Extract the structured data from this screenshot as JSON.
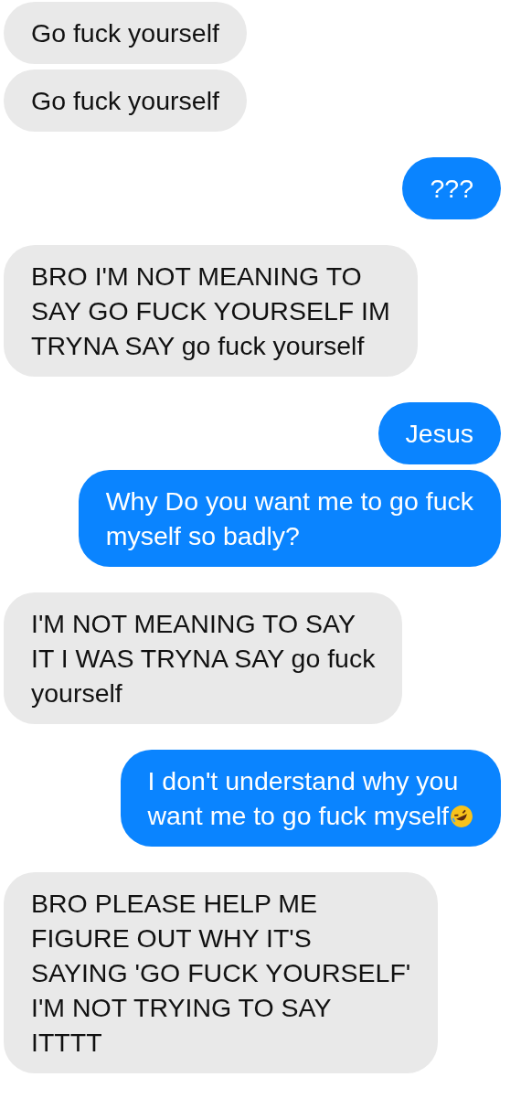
{
  "groups": [
    {
      "kind": "received",
      "messages": [
        {
          "text": "Go fuck yourself"
        },
        {
          "text": "Go fuck yourself"
        }
      ]
    },
    {
      "kind": "sent",
      "messages": [
        {
          "text": "???"
        }
      ]
    },
    {
      "kind": "received",
      "messages": [
        {
          "text": "BRO I'M NOT MEANING TO\nSAY GO FUCK YOURSELF IM\nTRYNA SAY go fuck yourself"
        }
      ]
    },
    {
      "kind": "sent",
      "messages": [
        {
          "text": "Jesus"
        },
        {
          "text": "Why Do you want me to go fuck\nmyself so badly?"
        }
      ]
    },
    {
      "kind": "received",
      "messages": [
        {
          "text": "I'M NOT MEANING TO SAY\nIT I WAS TRYNA SAY go fuck\nyourself"
        }
      ]
    },
    {
      "kind": "sent",
      "messages": [
        {
          "text": "I don't understand why you\nwant me to go fuck myself",
          "trailing_emoji": true
        }
      ]
    },
    {
      "kind": "received",
      "messages": [
        {
          "text": "BRO PLEASE HELP ME\nFIGURE OUT WHY IT'S\nSAYING 'GO FUCK YOURSELF'\nI'M NOT TRYING TO SAY\nITTTT"
        }
      ]
    }
  ]
}
